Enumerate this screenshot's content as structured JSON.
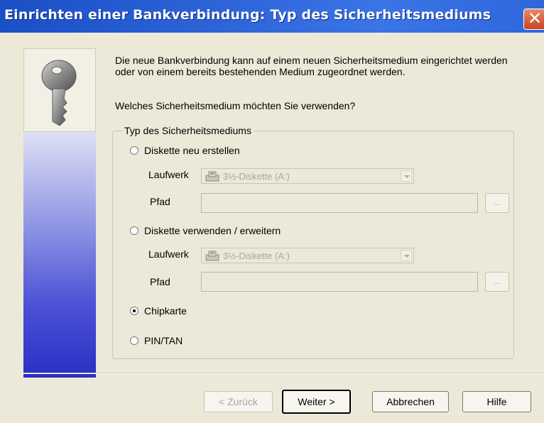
{
  "window": {
    "title": "Einrichten einer Bankverbindung: Typ des Sicherheitsmediums",
    "close_label": "✕"
  },
  "intro": {
    "text": "Die neue Bankverbindung kann  auf einem neuen Sicherheitsmedium eingerichtet werden oder von einem bereits bestehenden Medium zugeordnet werden.",
    "question": "Welches Sicherheitsmedium möchten Sie verwenden?"
  },
  "group": {
    "legend": "Typ des Sicherheitsmediums",
    "options": [
      {
        "label": "Diskette neu erstellen",
        "checked": false
      },
      {
        "label": "Diskette verwenden / erweitern",
        "checked": false
      },
      {
        "label": "Chipkarte",
        "checked": true
      },
      {
        "label": "PIN/TAN",
        "checked": false
      }
    ],
    "drive_label": "Laufwerk",
    "drive_value": "3½-Diskette (A:)",
    "path_label": "Pfad",
    "path_value": "",
    "browse_label": "..."
  },
  "buttons": {
    "back": "< Zurück",
    "next": "Weiter >",
    "cancel": "Abbrechen",
    "help": "Hilfe"
  },
  "icons": {
    "sidebar": "key-icon",
    "drive": "floppy-drive-icon"
  }
}
